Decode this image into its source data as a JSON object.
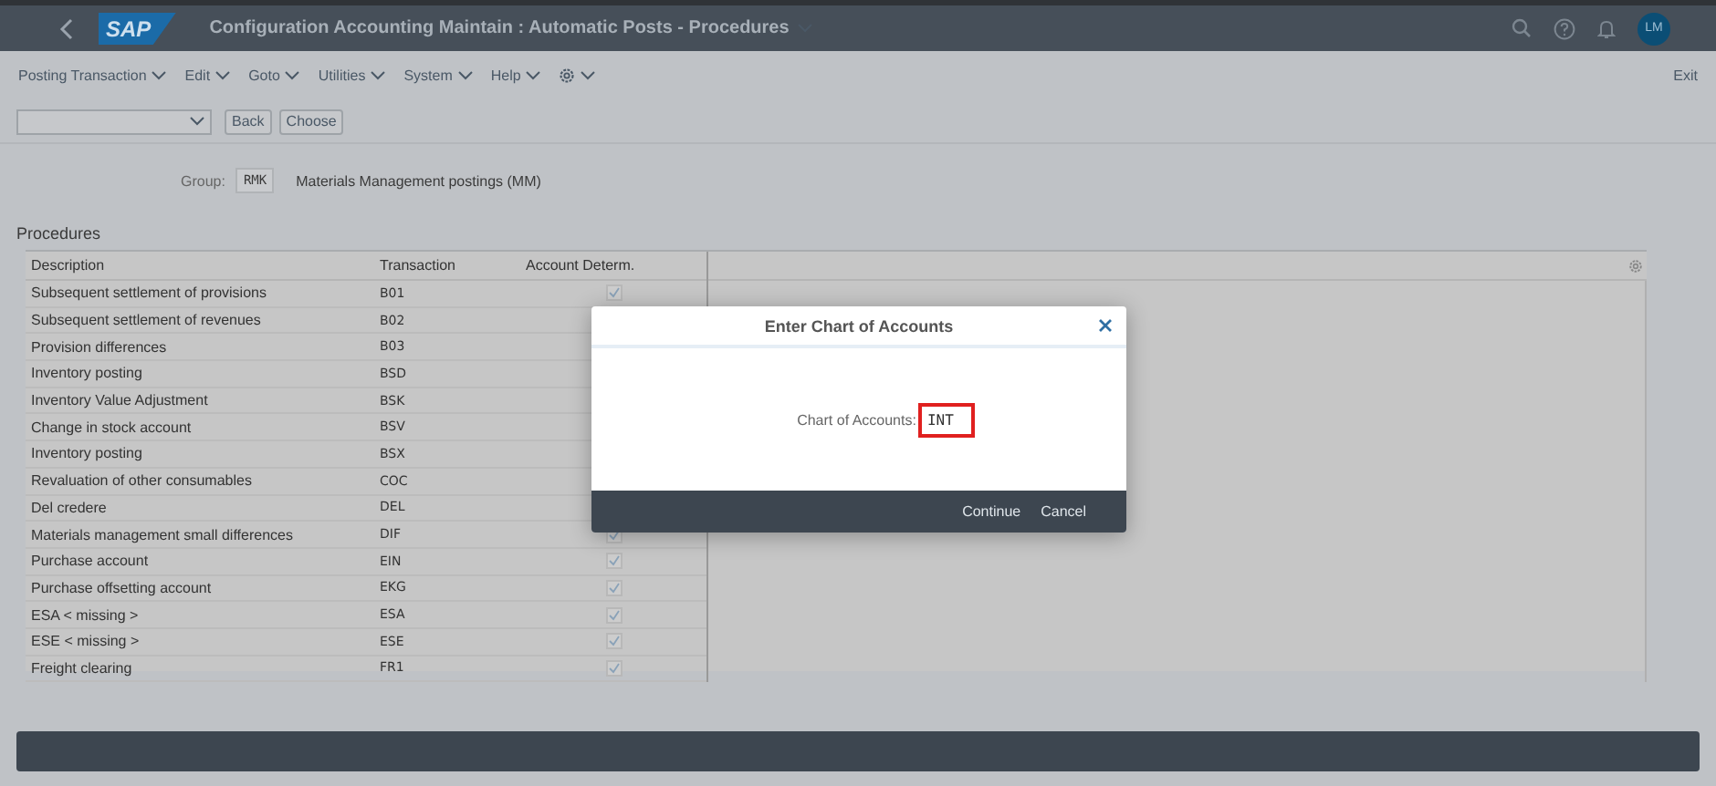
{
  "shell": {
    "logo": "SAP",
    "title": "Configuration Accounting Maintain : Automatic Posts - Procedures",
    "avatar": "LM"
  },
  "menu": [
    "Posting Transaction",
    "Edit",
    "Goto",
    "Utilities",
    "System",
    "Help"
  ],
  "exit": "Exit",
  "toolbar": {
    "buttons": [
      "Back",
      "Choose"
    ]
  },
  "group": {
    "label": "Group:",
    "value": "RMK",
    "text": "Materials Management postings (MM)"
  },
  "section_title": "Procedures",
  "table": {
    "columns": [
      "Description",
      "Transaction",
      "Account Determ."
    ],
    "rows": [
      {
        "description": "Subsequent settlement of provisions",
        "transaction": "B01",
        "checked": true
      },
      {
        "description": "Subsequent settlement of revenues",
        "transaction": "B02"
      },
      {
        "description": "Provision differences",
        "transaction": "B03"
      },
      {
        "description": "Inventory posting",
        "transaction": "BSD"
      },
      {
        "description": "Inventory Value Adjustment",
        "transaction": "BSK"
      },
      {
        "description": "Change in stock account",
        "transaction": "BSV"
      },
      {
        "description": "Inventory posting",
        "transaction": "BSX"
      },
      {
        "description": "Revaluation of other consumables",
        "transaction": "COC"
      },
      {
        "description": "Del credere",
        "transaction": "DEL"
      },
      {
        "description": "Materials management small differences",
        "transaction": "DIF",
        "checked": true
      },
      {
        "description": "Purchase account",
        "transaction": "EIN",
        "checked": true
      },
      {
        "description": "Purchase offsetting account",
        "transaction": "EKG",
        "checked": true
      },
      {
        "description": "ESA < missing >",
        "transaction": "ESA",
        "checked": true
      },
      {
        "description": "ESE < missing >",
        "transaction": "ESE",
        "checked": true
      },
      {
        "description": "Freight clearing",
        "transaction": "FR1",
        "checked": true
      }
    ]
  },
  "dialog": {
    "title": "Enter Chart of Accounts",
    "field_label": "Chart of Accounts:",
    "field_value": "INT",
    "buttons": [
      "Continue",
      "Cancel"
    ]
  }
}
